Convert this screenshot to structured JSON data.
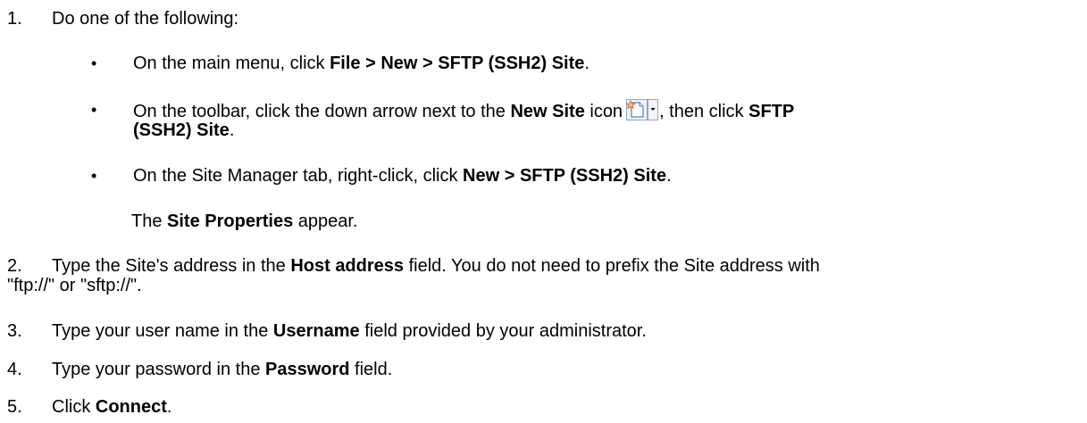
{
  "steps": [
    {
      "number": "1.",
      "text": "Do one of the following:",
      "options": [
        {
          "bullet": "•",
          "prefix": "On the main menu, click ",
          "bold": "File > New > SFTP (SSH2) Site",
          "suffix": "."
        },
        {
          "bullet": "•",
          "prefix": "On the toolbar, click the down arrow next to the ",
          "bold1": "New Site",
          "middle1": " icon",
          "icon": "new-site-icon",
          "middle2": ", then click ",
          "bold2a": "SFTP",
          "bold2b": "(SSH2) Site",
          "suffix": "."
        },
        {
          "bullet": "•",
          "prefix": "On the Site Manager tab, right-click, click ",
          "bold": "New > SFTP (SSH2) Site",
          "suffix": "."
        }
      ],
      "result_prefix": "The ",
      "result_bold": "Site Properties",
      "result_suffix": " appear."
    },
    {
      "number": "2.",
      "prefix": "Type the Site's address in the ",
      "bold": "Host address",
      "suffix": " field. You do not need to prefix the Site address with",
      "continuation": "\"ftp://\" or \"sftp://\"."
    },
    {
      "number": "3.",
      "prefix": "Type your user name in the ",
      "bold": "Username",
      "suffix": " field provided by your administrator."
    },
    {
      "number": "4.",
      "prefix": "Type your password in the ",
      "bold": "Password",
      "suffix": " field."
    },
    {
      "number": "5.",
      "prefix": "Click ",
      "bold": "Connect",
      "suffix": "."
    }
  ]
}
